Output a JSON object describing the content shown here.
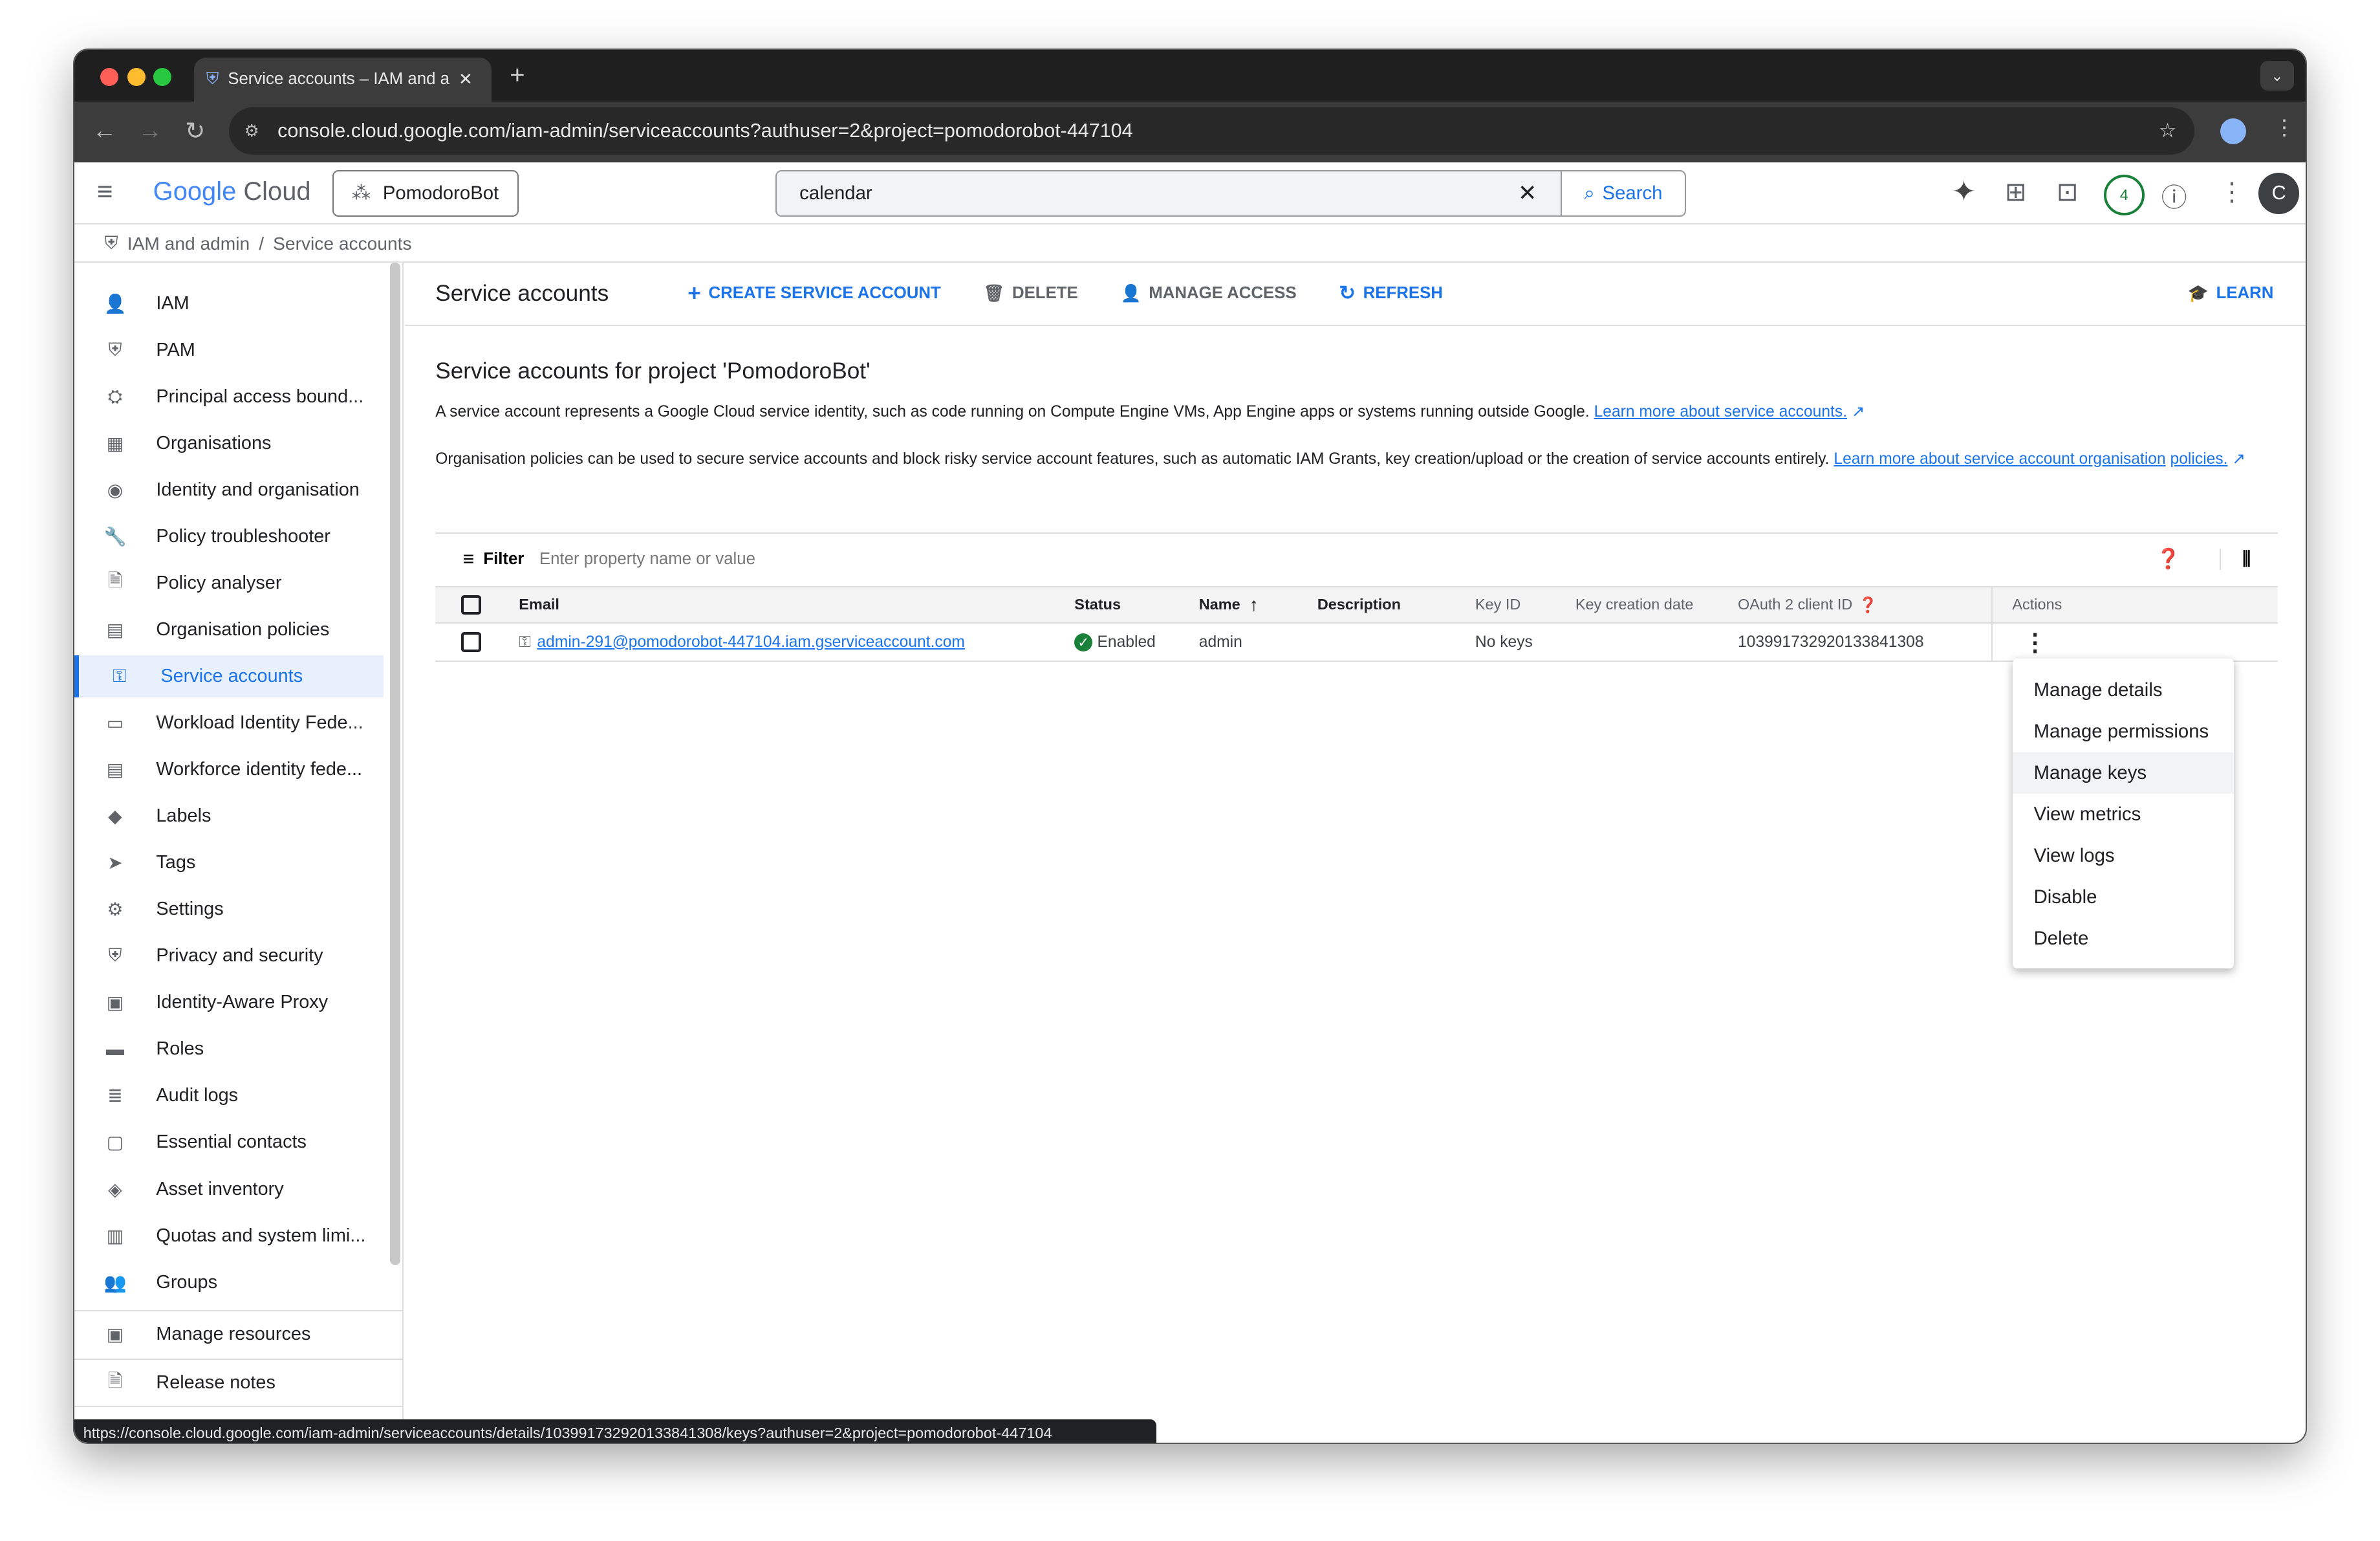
{
  "browser": {
    "tab_title": "Service accounts – IAM and a",
    "url": "console.cloud.google.com/iam-admin/serviceaccounts?authuser=2&project=pomodorobot-447104",
    "status_url": "https://console.cloud.google.com/iam-admin/serviceaccounts/details/103991732920133841308/keys?authuser=2&project=pomodorobot-447104"
  },
  "header": {
    "logo_google": "Google",
    "logo_cloud": "Cloud",
    "project": "PomodoroBot",
    "search_value": "calendar",
    "search_label": "Search",
    "notifications": "4",
    "avatar": "C"
  },
  "breadcrumb": {
    "parent": "IAM and admin",
    "current": "Service accounts"
  },
  "sidebar": {
    "items": [
      {
        "label": "IAM",
        "icon": "person-add-icon"
      },
      {
        "label": "PAM",
        "icon": "shield-icon"
      },
      {
        "label": "Principal access bound...",
        "icon": "policy-icon"
      },
      {
        "label": "Organisations",
        "icon": "building-icon"
      },
      {
        "label": "Identity and organisation",
        "icon": "account-circle-icon"
      },
      {
        "label": "Policy troubleshooter",
        "icon": "wrench-icon"
      },
      {
        "label": "Policy analyser",
        "icon": "document-search-icon"
      },
      {
        "label": "Organisation policies",
        "icon": "list-icon"
      },
      {
        "label": "Service accounts",
        "icon": "service-account-icon",
        "active": true
      },
      {
        "label": "Workload Identity Fede...",
        "icon": "id-card-icon"
      },
      {
        "label": "Workforce identity fede...",
        "icon": "list-icon"
      },
      {
        "label": "Labels",
        "icon": "label-icon"
      },
      {
        "label": "Tags",
        "icon": "tag-icon"
      },
      {
        "label": "Settings",
        "icon": "gear-icon"
      },
      {
        "label": "Privacy and security",
        "icon": "shield-icon"
      },
      {
        "label": "Identity-Aware Proxy",
        "icon": "proxy-icon"
      },
      {
        "label": "Roles",
        "icon": "hat-icon"
      },
      {
        "label": "Audit logs",
        "icon": "lines-icon"
      },
      {
        "label": "Essential contacts",
        "icon": "contact-icon"
      },
      {
        "label": "Asset inventory",
        "icon": "diamond-icon"
      },
      {
        "label": "Quotas and system limi...",
        "icon": "quota-icon"
      },
      {
        "label": "Groups",
        "icon": "groups-icon"
      }
    ],
    "manage_resources": "Manage resources",
    "release_notes": "Release notes",
    "collapse": "<|"
  },
  "toolbar": {
    "title": "Service accounts",
    "create": "CREATE SERVICE ACCOUNT",
    "delete": "DELETE",
    "manage_access": "MANAGE ACCESS",
    "refresh": "REFRESH",
    "learn": "LEARN"
  },
  "content": {
    "heading": "Service accounts for project 'PomodoroBot'",
    "p1": "A service account represents a Google Cloud service identity, such as code running on Compute Engine VMs, App Engine apps or systems running outside Google.",
    "p1_link": "Learn more about service accounts.",
    "p2": "Organisation policies can be used to secure service accounts and block risky service account features, such as automatic IAM Grants, key creation/upload or the creation of service accounts entirely.",
    "p2_link_a": "Learn more about service account organisation",
    "p2_link_b": "policies."
  },
  "filter": {
    "label": "Filter",
    "placeholder": "Enter property name or value"
  },
  "table": {
    "columns": [
      "Email",
      "Status",
      "Name",
      "Description",
      "Key ID",
      "Key creation date",
      "OAuth 2 client ID",
      "Actions"
    ],
    "rows": [
      {
        "email": "admin-291@pomodorobot-447104.iam.gserviceaccount.com",
        "status": "Enabled",
        "name": "admin",
        "description": "",
        "key_id": "No keys",
        "key_creation_date": "",
        "oauth_client_id": "103991732920133841308"
      }
    ]
  },
  "actions_menu": {
    "items": [
      "Manage details",
      "Manage permissions",
      "Manage keys",
      "View metrics",
      "View logs",
      "Disable",
      "Delete"
    ],
    "hovered": "Manage keys"
  },
  "colors": {
    "accent": "#1a73e8",
    "enabled": "#188038"
  }
}
